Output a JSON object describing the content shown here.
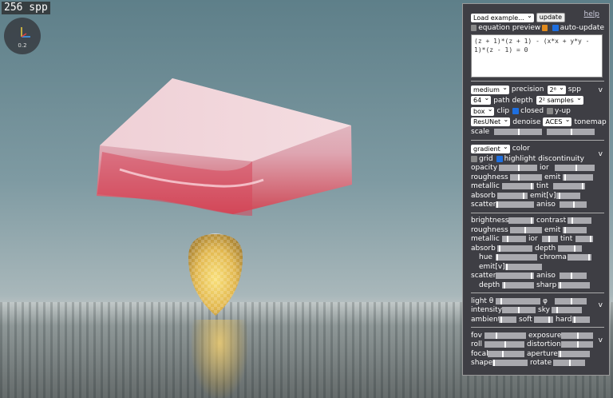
{
  "hud": {
    "spp": "256 spp",
    "gizmo_scale": "0.2"
  },
  "panel": {
    "top": {
      "load_example": "Load example...",
      "update": "update",
      "help": "help",
      "equation_preview": "equation preview",
      "auto_update": "auto-update",
      "equation": "(z + 1)*(z + 1) - (x*x + y*y - 1)*(z - 1) = 0"
    },
    "render": {
      "precision_value": "medium",
      "precision_label": "precision",
      "spp_value": "2⁸",
      "spp_label": "spp",
      "depth_value": "64",
      "depth_label": "path depth",
      "samples_value": "2² samples",
      "clip_value": "box",
      "clip_label": "clip",
      "closed_label": "closed",
      "yup_label": "y-up",
      "denoise_value": "ResUNet",
      "denoise_label": "denoise",
      "tonemap_value": "ACES",
      "tonemap_label": "tonemap",
      "scale_label": "scale"
    },
    "material": {
      "color_value": "gradient",
      "color_label": "color",
      "grid_label": "grid",
      "highlight_label": "highlight discontinuity",
      "opacity": "opacity",
      "ior": "ior",
      "roughness": "roughness",
      "emit": "emit",
      "metallic": "metallic",
      "tint": "tint",
      "absorb": "absorb",
      "emitv": "emit[v]",
      "scatter": "scatter",
      "aniso": "aniso"
    },
    "ground": {
      "brightness": "brightness",
      "contrast": "contrast",
      "roughness": "roughness",
      "emit": "emit",
      "metallic": "metallic",
      "ior": "ior",
      "tint": "tint",
      "absorb": "absorb",
      "depth": "depth",
      "hue": "hue",
      "chroma": "chroma",
      "emitv": "emit[v]",
      "scatter": "scatter",
      "aniso": "aniso",
      "depth2": "depth",
      "sharp": "sharp"
    },
    "light": {
      "theta": "light θ",
      "phi": "φ",
      "intensity": "intensity",
      "sky": "sky",
      "ambient": "ambient",
      "soft": "soft",
      "hard": "hard"
    },
    "camera": {
      "fov": "fov",
      "exposure": "exposure",
      "roll": "roll",
      "distortion": "distortion",
      "focal": "focal",
      "aperture": "aperture",
      "shape": "shape",
      "rotate": "rotate"
    },
    "collapse_glyph": "v"
  },
  "colors": {
    "panel_bg": "#3e3e44",
    "checkbox_on": "#1e6fe0",
    "checkbox_orange": "#e08a1e"
  }
}
